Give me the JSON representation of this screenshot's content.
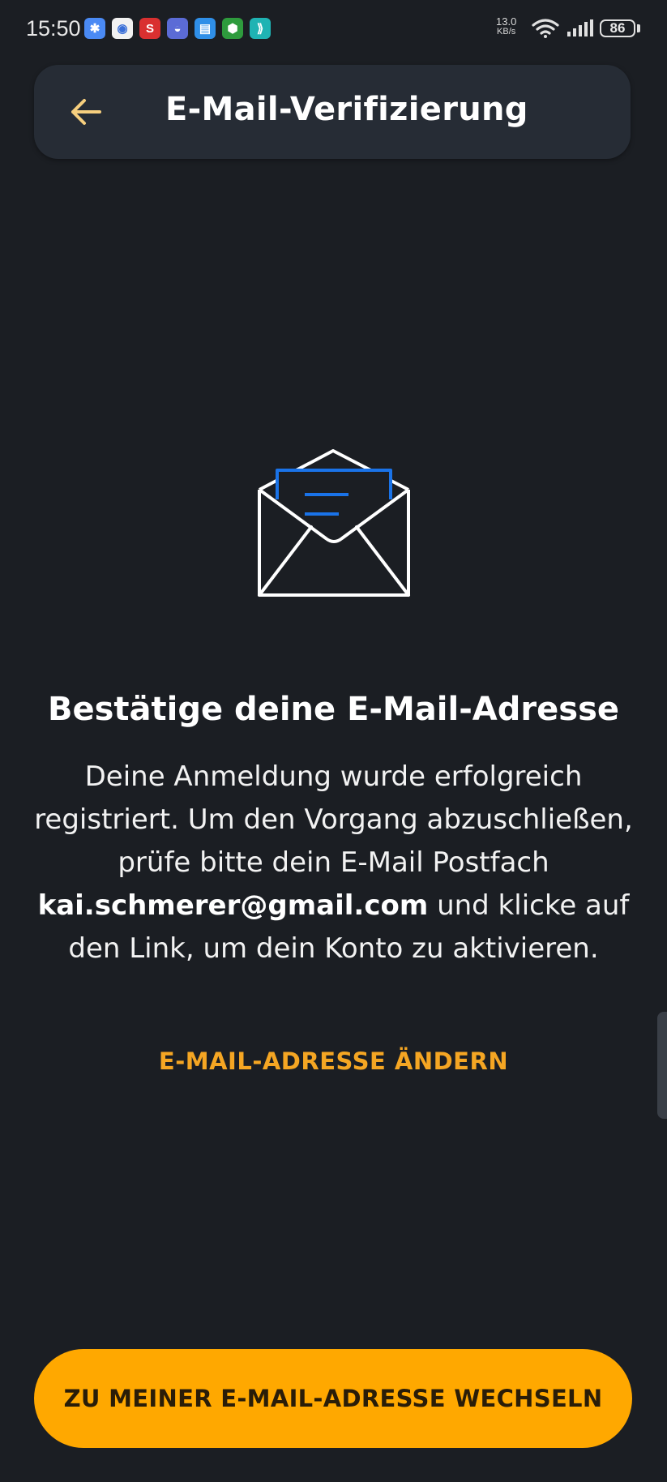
{
  "status_bar": {
    "time": "15:50",
    "net_speed_value": "13.0",
    "net_speed_unit": "KB/s",
    "battery": "86",
    "notification_icons": [
      {
        "name": "pinwheel-app-icon",
        "color": "#4a8af4",
        "glyph": "✱"
      },
      {
        "name": "bubble-app-icon",
        "color": "#f2f2f2",
        "glyph": "◉"
      },
      {
        "name": "s-app-icon",
        "color": "#d93030",
        "glyph": "S"
      },
      {
        "name": "chat-app-icon",
        "color": "#5b6bd6",
        "glyph": "◒"
      },
      {
        "name": "clipboard-app-icon",
        "color": "#2f8fe8",
        "glyph": "▤"
      },
      {
        "name": "shield-app-icon",
        "color": "#2e9b3d",
        "glyph": "⬢"
      },
      {
        "name": "teal-app-icon",
        "color": "#1fb3b3",
        "glyph": "⟫"
      }
    ]
  },
  "app_bar": {
    "title": "E-Mail-Verifizierung",
    "back_icon": "arrow-left-icon"
  },
  "colors": {
    "background": "#1b1e23",
    "app_bar": "#262c35",
    "accent": "#ffa800",
    "link": "#f5a623",
    "envelope_letter": "#1a73e8"
  },
  "content": {
    "illustration": "open-envelope-icon",
    "headline": "Bestätige deine E-Mail-Adresse",
    "body_before": "Deine Anmeldung wurde erfolgreich registriert. Um den Vorgang abzuschließen, prüfe bitte dein E-Mail Postfach ",
    "email": "kai.schmerer@gmail.com",
    "body_after": "  und klicke auf den Link, um dein Konto zu aktivieren.",
    "change_email_link": "E-MAIL-ADRESSE ÄNDERN"
  },
  "footer": {
    "primary_button": "ZU MEINER E-MAIL-ADRESSE WECHSELN"
  }
}
